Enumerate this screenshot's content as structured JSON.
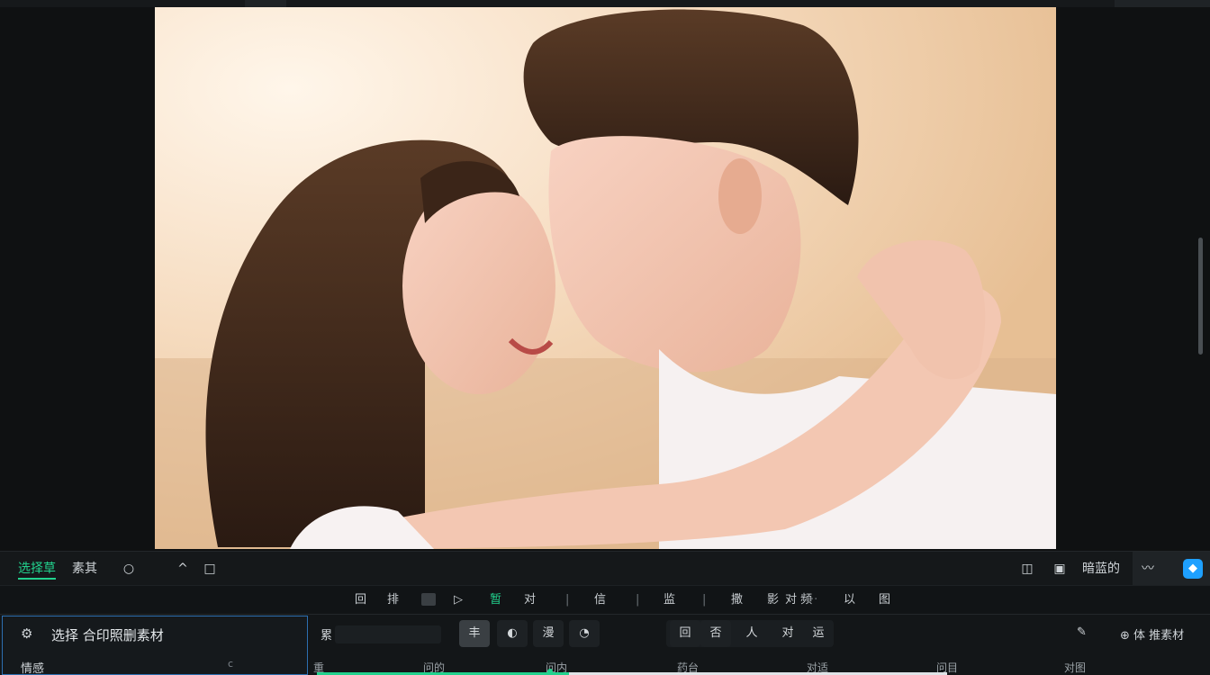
{
  "toolbar": {
    "tab_select": "选择草",
    "tab_material": "素其",
    "right_label": "暗蓝的"
  },
  "toolbar2": {
    "items": [
      "回",
      "排",
      "暂",
      "对",
      "信",
      "监",
      "撒",
      "影",
      "对 频",
      "以",
      "图"
    ]
  },
  "panel": {
    "title": "选择 合印照删素材",
    "subtitle": "情感",
    "dot_label": "c",
    "field_label": "累",
    "pills": [
      "丰",
      "漫"
    ],
    "group_pills": [
      "回",
      "否",
      "人",
      "对",
      "运"
    ],
    "right_action": "体 推素材"
  },
  "timeline": {
    "ticks": [
      "重",
      "问的",
      "问内",
      "药台",
      "对适",
      "问目",
      "对图"
    ]
  },
  "colors": {
    "accent": "#22d28e",
    "focus_border": "#2d6fb0",
    "ai_button": "#1ea0ff"
  },
  "icons": [
    "search-icon",
    "chevron-up-icon",
    "split-icon",
    "layout-icon",
    "image-icon",
    "wave-icon",
    "ai-icon",
    "settings-icon",
    "edit-icon"
  ],
  "preview": {
    "description_visible": false
  }
}
